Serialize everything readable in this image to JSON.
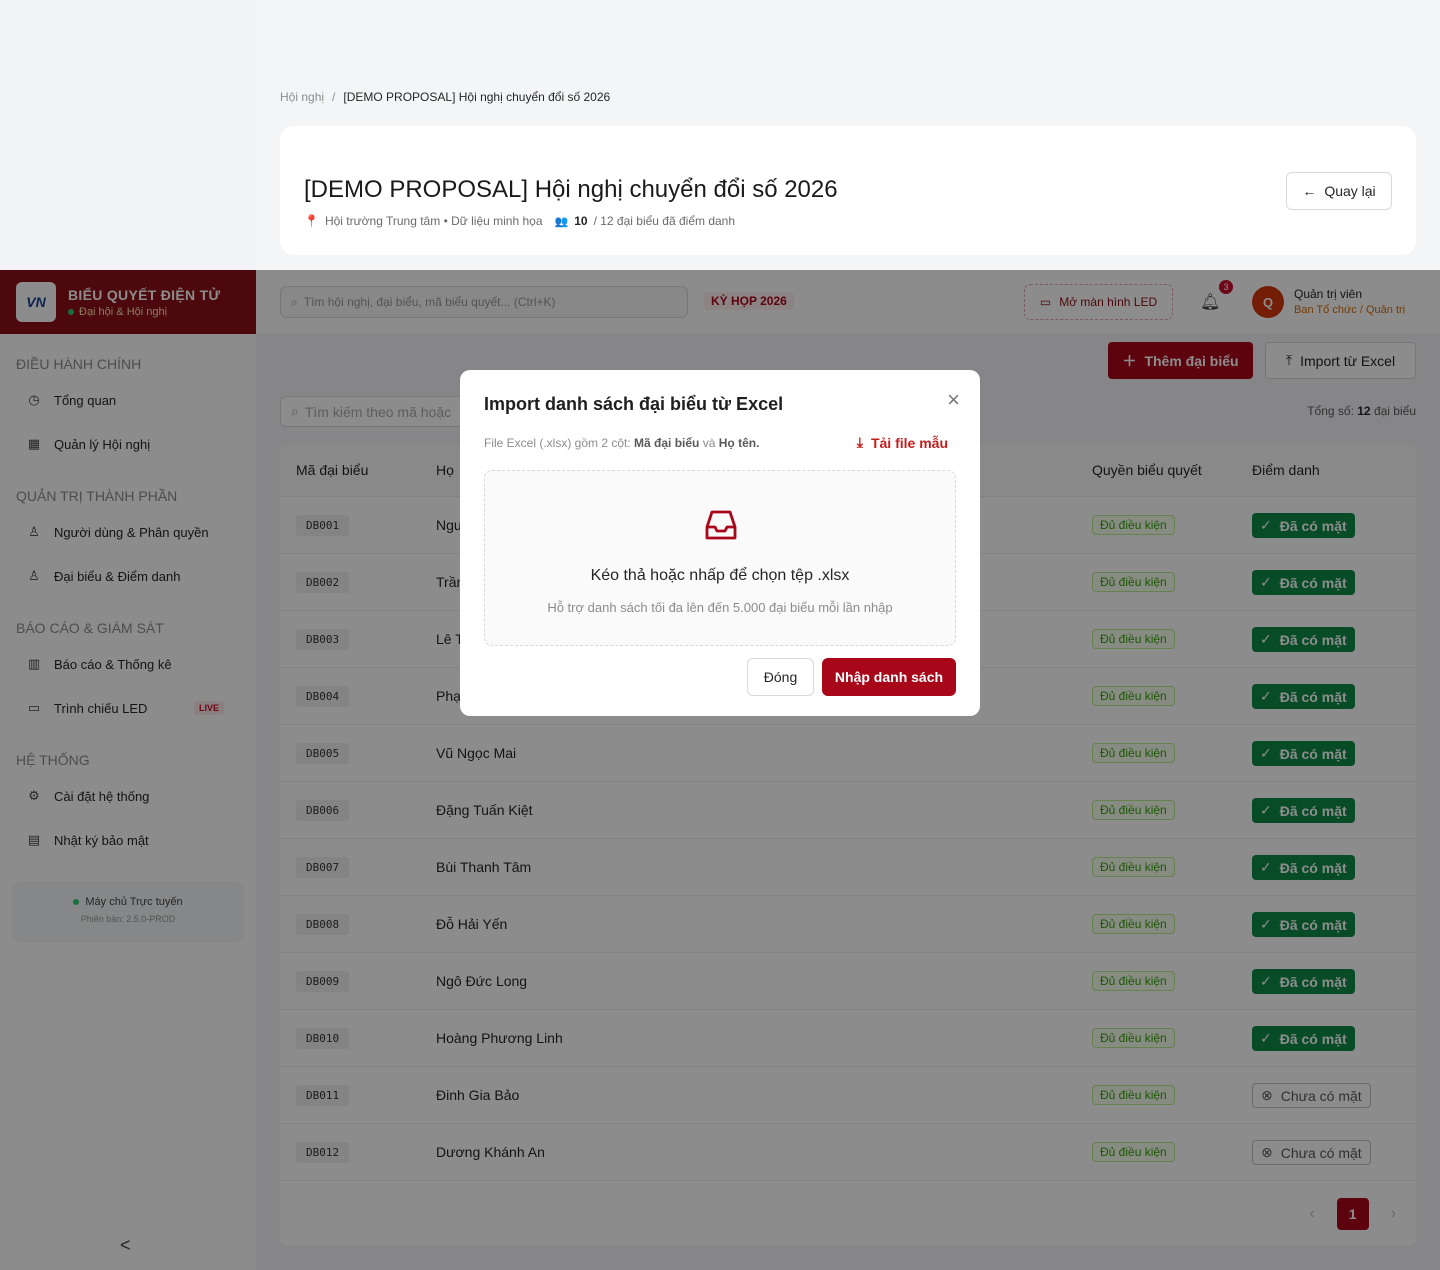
{
  "breadcrumb": {
    "root": "Hội nghị",
    "sep": "/",
    "current": "[DEMO PROPOSAL] Hội nghị chuyển đổi số 2026"
  },
  "conference": {
    "title": "[DEMO PROPOSAL] Hội nghị chuyển đổi số 2026",
    "location": "Hội trường Trung tâm • Dữ liệu minh họa",
    "checked_in": "10",
    "checked_in_rest": "/ 12 đại biểu đã điểm danh",
    "back_label": "Quay lại"
  },
  "brand": {
    "logo": "VN",
    "title": "BIỂU QUYẾT ĐIỆN TỬ",
    "subtitle": "Đại hội & Hội nghị"
  },
  "sidebar": {
    "sections": [
      {
        "title": "ĐIỀU HÀNH CHÍNH",
        "items": [
          {
            "label": "Tổng quan",
            "icon": "dashboard-icon"
          },
          {
            "label": "Quản lý Hội nghị",
            "icon": "calendar-icon"
          }
        ]
      },
      {
        "title": "QUẢN TRỊ THÀNH PHẦN",
        "items": [
          {
            "label": "Người dùng & Phân quyền",
            "icon": "user-icon"
          },
          {
            "label": "Đại biểu & Điểm danh",
            "icon": "users-icon"
          }
        ]
      },
      {
        "title": "BÁO CÁO & GIÁM SÁT",
        "items": [
          {
            "label": "Báo cáo & Thống kê",
            "icon": "bar-chart-icon"
          },
          {
            "label": "Trình chiếu LED",
            "icon": "monitor-icon",
            "badge": "LIVE"
          }
        ]
      },
      {
        "title": "HỆ THỐNG",
        "items": [
          {
            "label": "Cài đặt hệ thống",
            "icon": "gear-icon"
          },
          {
            "label": "Nhật ký bảo mật",
            "icon": "audit-icon"
          }
        ]
      }
    ],
    "server_status": "Máy chủ Trực tuyến",
    "version": "Phiên bản: 2.5.0-PROD",
    "collapse": "<"
  },
  "header": {
    "search_placeholder": "Tìm hội nghị, đại biểu, mã biểu quyết... (Ctrl+K)",
    "term_badge": "KỲ HỌP 2026",
    "led_button": "Mở màn hình LED",
    "notif_count": "3",
    "avatar_initial": "Q",
    "user_name": "Quản trị viên",
    "user_role": "Ban Tổ chức / Quản trị"
  },
  "main": {
    "add_button": "Thêm đại biểu",
    "import_button": "Import từ Excel",
    "table_search_placeholder": "Tìm kiếm theo mã hoặc",
    "total_prefix": "Tổng số:",
    "total_count": "12",
    "total_suffix": "đại biểu",
    "columns": {
      "code": "Mã đại biểu",
      "name": "Họ",
      "rights": "Quyền biểu quyết",
      "attendance": "Điểm danh"
    },
    "rows": [
      {
        "code": "DB001",
        "name": "Ngu",
        "rights": "Đủ điều kiện",
        "attendance": "Đã có mặt",
        "present": true
      },
      {
        "code": "DB002",
        "name": "Trần",
        "rights": "Đủ điều kiện",
        "attendance": "Đã có mặt",
        "present": true
      },
      {
        "code": "DB003",
        "name": "Lê T",
        "rights": "Đủ điều kiện",
        "attendance": "Đã có mặt",
        "present": true
      },
      {
        "code": "DB004",
        "name": "Phạ",
        "rights": "Đủ điều kiện",
        "attendance": "Đã có mặt",
        "present": true
      },
      {
        "code": "DB005",
        "name": "Vũ Ngọc Mai",
        "rights": "Đủ điều kiện",
        "attendance": "Đã có mặt",
        "present": true
      },
      {
        "code": "DB006",
        "name": "Đặng Tuấn Kiệt",
        "rights": "Đủ điều kiện",
        "attendance": "Đã có mặt",
        "present": true
      },
      {
        "code": "DB007",
        "name": "Bùi Thanh Tâm",
        "rights": "Đủ điều kiện",
        "attendance": "Đã có mặt",
        "present": true
      },
      {
        "code": "DB008",
        "name": "Đỗ Hải Yến",
        "rights": "Đủ điều kiện",
        "attendance": "Đã có mặt",
        "present": true
      },
      {
        "code": "DB009",
        "name": "Ngô Đức Long",
        "rights": "Đủ điều kiện",
        "attendance": "Đã có mặt",
        "present": true
      },
      {
        "code": "DB010",
        "name": "Hoàng Phương Linh",
        "rights": "Đủ điều kiện",
        "attendance": "Đã có mặt",
        "present": true
      },
      {
        "code": "DB011",
        "name": "Đinh Gia Bảo",
        "rights": "Đủ điều kiện",
        "attendance": "Chưa có mặt",
        "present": false
      },
      {
        "code": "DB012",
        "name": "Dương Khánh An",
        "rights": "Đủ điều kiện",
        "attendance": "Chưa có mặt",
        "present": false
      }
    ],
    "page": "1"
  },
  "modal": {
    "title": "Import danh sách đại biểu từ Excel",
    "desc_prefix": "File Excel (.xlsx) gồm 2 cột:",
    "desc_col1": "Mã đại biểu",
    "desc_and": "và",
    "desc_col2": "Họ tên.",
    "download_label": "Tải file mẫu",
    "drop_main": "Kéo thả hoặc nhấp để chọn tệp .xlsx",
    "drop_hint": "Hỗ trợ danh sách tối đa lên đến 5.000 đại biểu mỗi lần nhập",
    "close_label": "Đóng",
    "submit_label": "Nhập danh sách"
  },
  "colors": {
    "brand": "#8b0f16",
    "primary": "#a8071a",
    "present": "#0e8b47"
  }
}
